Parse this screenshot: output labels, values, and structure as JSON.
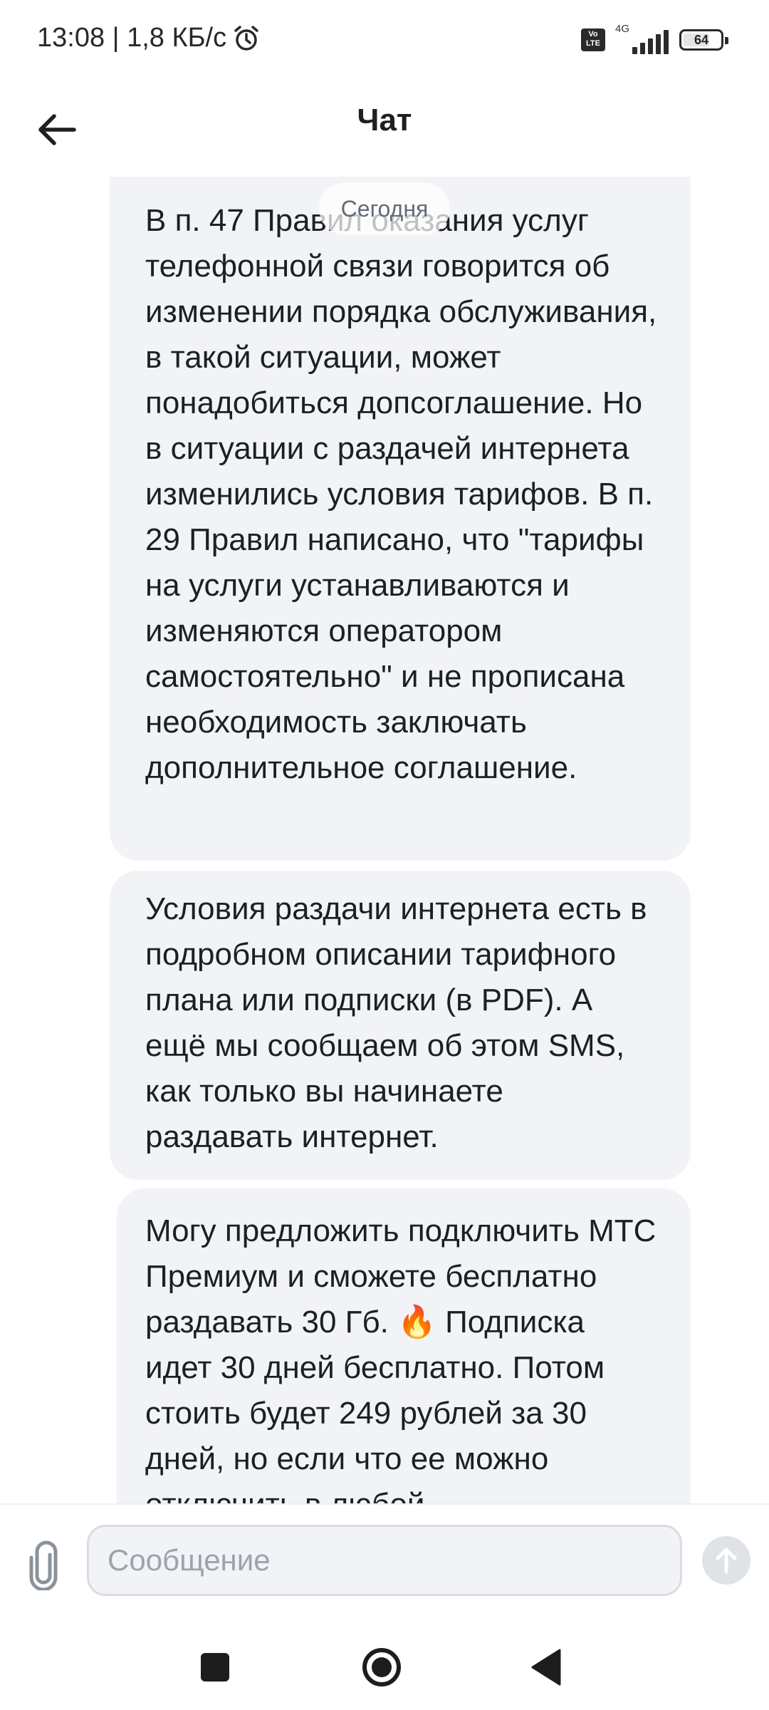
{
  "status_bar": {
    "time_speed": "13:08 | 1,8 КБ/с",
    "alarm_icon": "alarm-clock-icon",
    "volte": "Vo LTE",
    "network": "4G",
    "battery": "64"
  },
  "header": {
    "title": "Чат",
    "back_icon": "arrow-left-icon"
  },
  "chat": {
    "date_label": "Сегодня",
    "messages": [
      {
        "text": "В п. 47 Правил оказания услуг телефонной связи говорится об изменении порядка обслуживания, в такой ситуации, может понадобиться допсоглашение. Но в ситуации с раздачей интернета изменились условия тарифов. В п. 29 Правил написано, что \"тарифы на услуги устанавливаются и изменяются оператором самостоятельно\" и не прописана необходимость заключать дополнительное соглашение."
      },
      {
        "text": "Условия раздачи интернета есть в подробном описании тарифного плана или подписки (в PDF). А ещё мы сообщаем об этом SMS, как только вы начинаете раздавать интернет."
      },
      {
        "text": "Могу предложить подключить МТС Премиум и сможете бесплатно раздавать 30 Гб.  🔥 Подписка идет 30 дней бесплатно.  Потом стоить будет 249 рублей за 30 дней, но если что ее можно отключить в любой"
      }
    ]
  },
  "composer": {
    "placeholder": "Сообщение",
    "attach_icon": "paperclip-icon",
    "send_icon": "send-arrow-up-icon"
  },
  "navigation": {
    "recents_icon": "square-icon",
    "home_icon": "circle-home-icon",
    "back_icon": "triangle-back-icon"
  }
}
